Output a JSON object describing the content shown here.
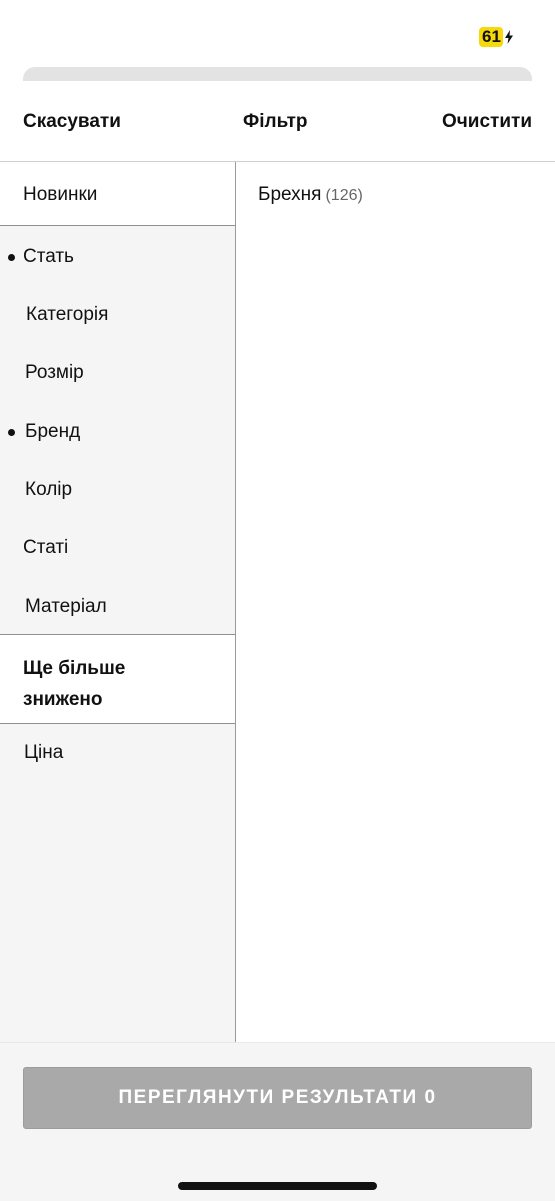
{
  "status_bar": {
    "battery_level": "61"
  },
  "header": {
    "cancel": "Скасувати",
    "title": "Фільтр",
    "clear": "Очистити"
  },
  "sidebar": {
    "new_arrivals": "Новинки",
    "items": [
      {
        "label": "Стать",
        "selected": true
      },
      {
        "label": "Категорія",
        "selected": false
      },
      {
        "label": "Розмір",
        "selected": false
      },
      {
        "label": "Бренд",
        "selected": true
      },
      {
        "label": "Колір",
        "selected": false
      },
      {
        "label": "Статі",
        "selected": false
      },
      {
        "label": "Матеріал",
        "selected": false
      }
    ],
    "sale": "Ще більше знижено",
    "price": "Ціна"
  },
  "options": [
    {
      "label": "Брехня",
      "count": "(126)"
    }
  ],
  "footer": {
    "results_button": "ПЕРЕГЛЯНУТИ РЕЗУЛЬТАТИ 0"
  }
}
